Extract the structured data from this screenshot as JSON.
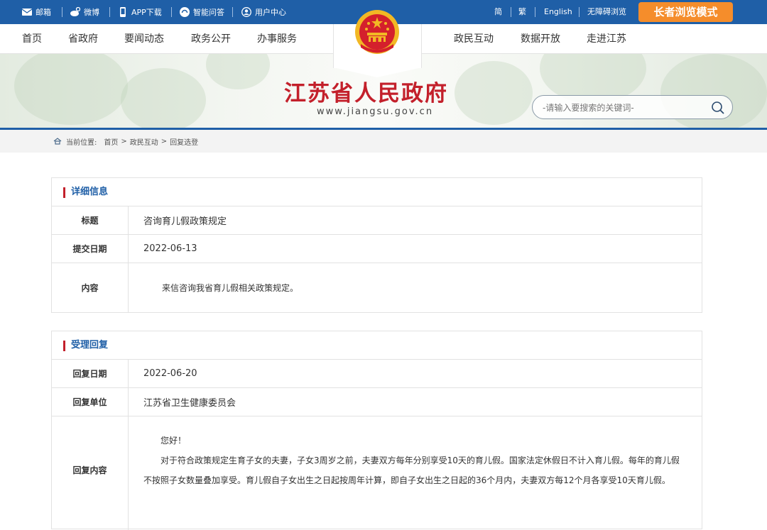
{
  "topbar": {
    "mail": "邮箱",
    "weibo": "微博",
    "app": "APP下载",
    "qa": "智能问答",
    "user": "用户中心",
    "simplified": "简",
    "traditional": "繁",
    "english": "English",
    "accessible": "无障碍浏览",
    "elder_mode": "长者浏览模式"
  },
  "nav": {
    "left": [
      "首页",
      "省政府",
      "要闻动态",
      "政务公开",
      "办事服务"
    ],
    "right": [
      "政民互动",
      "数据开放",
      "走进江苏"
    ]
  },
  "banner": {
    "title": "江苏省人民政府",
    "url": "www.jiangsu.gov.cn",
    "search_placeholder": "-请输入要搜索的关键词-"
  },
  "breadcrumb": {
    "label": "当前位置:",
    "items": [
      "首页",
      "政民互动",
      "回复选登"
    ],
    "separator": ">"
  },
  "detail": {
    "heading": "详细信息",
    "title_label": "标题",
    "title_value": "咨询育儿假政策规定",
    "date_label": "提交日期",
    "date_value": "2022-06-13",
    "content_label": "内容",
    "content_value": "来信咨询我省育儿假相关政策规定。"
  },
  "reply": {
    "heading": "受理回复",
    "date_label": "回复日期",
    "date_value": "2022-06-20",
    "unit_label": "回复单位",
    "unit_value": "江苏省卫生健康委员会",
    "content_label": "回复内容",
    "greeting": "您好！",
    "body": "对于符合政策规定生育子女的夫妻，子女3周岁之前，夫妻双方每年分别享受10天的育儿假。国家法定休假日不计入育儿假。每年的育儿假不按照子女数量叠加享受。育儿假自子女出生之日起按周年计算，即自子女出生之日起的36个月内，夫妻双方每12个月各享受10天育儿假。"
  },
  "colors": {
    "brand_blue": "#1f5fa7",
    "brand_red": "#c3202b",
    "elder_orange": "#f58d2b"
  }
}
